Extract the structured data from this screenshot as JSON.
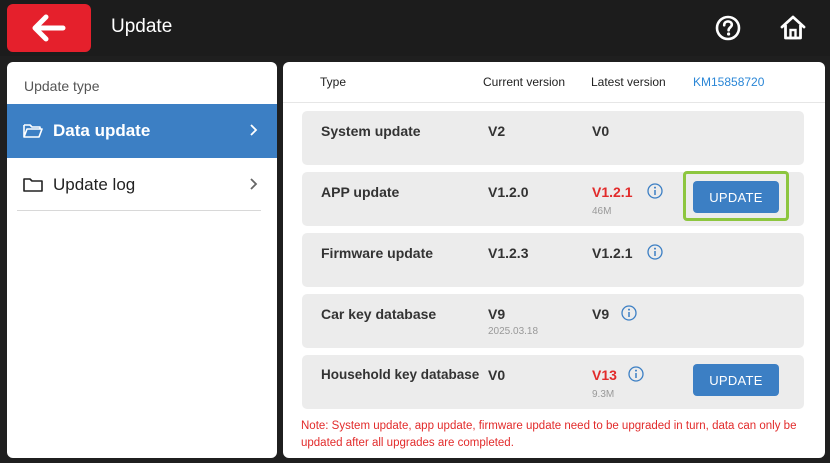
{
  "header": {
    "title": "Update"
  },
  "sidebar": {
    "heading": "Update type",
    "items": [
      {
        "label": "Data update",
        "active": true
      },
      {
        "label": "Update log",
        "active": false
      }
    ]
  },
  "table": {
    "columns": {
      "type": "Type",
      "current": "Current version",
      "latest": "Latest version",
      "serial": "KM15858720"
    },
    "rows": [
      {
        "name": "System update",
        "current": "V2",
        "current_sub": "",
        "latest": "V0",
        "latest_sub": "",
        "latest_highlight": false,
        "info": false,
        "button": ""
      },
      {
        "name": "APP update",
        "current": "V1.2.0",
        "current_sub": "",
        "latest": "V1.2.1",
        "latest_sub": "46M",
        "latest_highlight": true,
        "info": true,
        "button": "UPDATE"
      },
      {
        "name": "Firmware update",
        "current": "V1.2.3",
        "current_sub": "",
        "latest": "V1.2.1",
        "latest_sub": "",
        "latest_highlight": false,
        "info": true,
        "button": ""
      },
      {
        "name": "Car key database",
        "current": "V9",
        "current_sub": "2025.03.18",
        "latest": "V9",
        "latest_sub": "",
        "latest_highlight": false,
        "info": true,
        "button": ""
      },
      {
        "name": "Household key database",
        "current": "V0",
        "current_sub": "",
        "latest": "V13",
        "latest_sub": "9.3M",
        "latest_highlight": true,
        "info": true,
        "button": "UPDATE"
      }
    ]
  },
  "note": "Note: System update, app update, firmware update need to be upgraded in turn, data can only be updated after all upgrades are completed.",
  "colors": {
    "accent": "#3c7fc4",
    "back_button": "#e5202c",
    "highlight_red": "#e22b2b",
    "focus_green": "#8dc63f"
  },
  "icons": {
    "back": "arrow-left-icon",
    "help": "question-circle-icon",
    "home": "home-icon",
    "folder": "folder-icon",
    "chevron": "chevron-right-icon",
    "info": "info-circle-icon"
  }
}
